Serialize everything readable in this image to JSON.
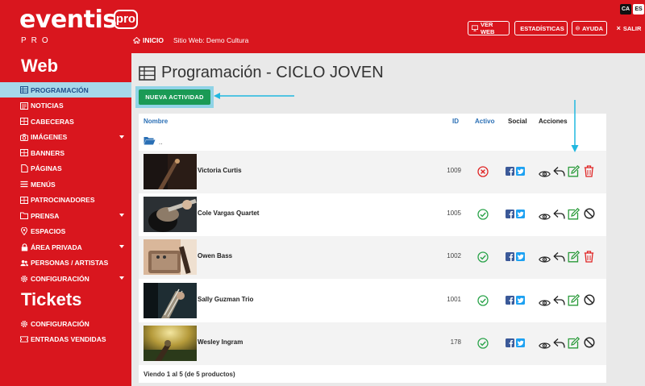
{
  "header": {
    "logo": "eventis",
    "logo_badge": "pro",
    "logo_sub": "PRO",
    "breadcrumb": {
      "home": "INICIO",
      "site": "Sitio Web: Demo Cultura"
    },
    "lang": [
      "CA",
      "ES"
    ],
    "buttons": {
      "ver_web": "VER WEB",
      "estadisticas": "ESTADÍSTICAS",
      "ayuda": "AYUDA",
      "salir": "SALIR"
    }
  },
  "sidebar": {
    "section_web": "Web",
    "web_items": [
      {
        "label": "PROGRAMACIÓN",
        "icon": "table-icon",
        "active": true
      },
      {
        "label": "NOTICIAS",
        "icon": "newspaper-icon"
      },
      {
        "label": "CABECERAS",
        "icon": "grid-icon"
      },
      {
        "label": "IMÁGENES",
        "icon": "camera-icon",
        "has_submenu": true
      },
      {
        "label": "BANNERS",
        "icon": "grid-icon"
      },
      {
        "label": "PÁGINAS",
        "icon": "file-icon"
      },
      {
        "label": "MENÚS",
        "icon": "list-icon"
      },
      {
        "label": "PATROCINADORES",
        "icon": "grid-icon"
      },
      {
        "label": "PRENSA",
        "icon": "folder-icon",
        "has_submenu": true
      },
      {
        "label": "ESPACIOS",
        "icon": "map-marker-icon"
      },
      {
        "label": "ÁREA PRIVADA",
        "icon": "lock-icon",
        "has_submenu": true
      },
      {
        "label": "PERSONAS / ARTISTAS",
        "icon": "users-icon"
      },
      {
        "label": "CONFIGURACIÓN",
        "icon": "gear-icon",
        "has_submenu": true
      }
    ],
    "section_tickets": "Tickets",
    "ticket_items": [
      {
        "label": "CONFIGURACIÓN",
        "icon": "gear-icon"
      },
      {
        "label": "ENTRADAS VENDIDAS",
        "icon": "ticket-icon"
      }
    ]
  },
  "main": {
    "title": "Programación - CICLO JOVEN",
    "new_button": "NUEVA ACTIVIDAD",
    "table": {
      "columns": {
        "name": "Nombre",
        "id": "ID",
        "active": "Activo",
        "social": "Social",
        "actions": "Acciones"
      },
      "parent_folder": "..",
      "rows": [
        {
          "name": "Victoria Curtis",
          "id": "1009",
          "active": false,
          "delete_action": "trash"
        },
        {
          "name": "Cole Vargas Quartet",
          "id": "1005",
          "active": true,
          "delete_action": "ban"
        },
        {
          "name": "Owen Bass",
          "id": "1002",
          "active": true,
          "delete_action": "trash"
        },
        {
          "name": "Sally Guzman Trio",
          "id": "1001",
          "active": true,
          "delete_action": "ban"
        },
        {
          "name": "Wesley Ingram",
          "id": "178",
          "active": true,
          "delete_action": "ban"
        }
      ],
      "footer": "Viendo 1 al 5 (de 5 productos)"
    }
  },
  "colors": {
    "brand_red": "#d9161e",
    "highlight": "#8fd3e6",
    "green": "#1a9a55",
    "arrow": "#21b8e0"
  }
}
